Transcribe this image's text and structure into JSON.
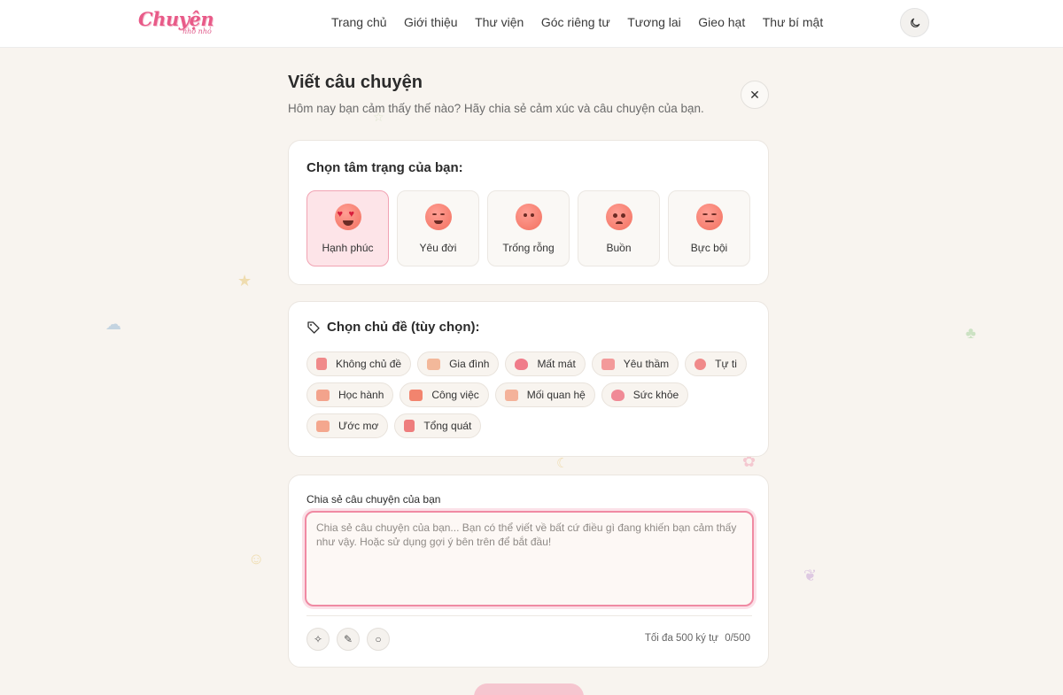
{
  "header": {
    "logo_main": "Chuyện",
    "logo_sub": "nho nhỏ",
    "nav": [
      "Trang chủ",
      "Giới thiệu",
      "Thư viện",
      "Góc riêng tư",
      "Tương lai",
      "Gieo hạt",
      "Thư bí mật"
    ],
    "theme_icon": "moon-icon"
  },
  "page": {
    "title": "Viết câu chuyện",
    "subtitle": "Hôm nay bạn cảm thấy thế nào? Hãy chia sẻ cảm xúc và câu chuyện của bạn.",
    "close_icon": "close-icon"
  },
  "mood": {
    "heading": "Chọn tâm trạng của bạn:",
    "selected": "Hạnh phúc",
    "options": [
      "Hạnh phúc",
      "Yêu đời",
      "Trống rỗng",
      "Buồn",
      "Bực bội"
    ]
  },
  "topic": {
    "heading": "Chọn chủ đề (tùy chọn):",
    "options": [
      "Không chủ đề",
      "Gia đình",
      "Mất mát",
      "Yêu thầm",
      "Tự ti",
      "Học hành",
      "Công việc",
      "Mối quan hệ",
      "Sức khỏe",
      "Ước mơ",
      "Tổng quát"
    ]
  },
  "story": {
    "label": "Chia sẻ câu chuyện của bạn",
    "value": "",
    "placeholder": "Chia sẻ câu chuyện của bạn... Bạn có thể viết về bất cứ điều gì đang khiến bạn cảm thấy như vậy. Hoặc sử dụng gợi ý bên trên để bắt đầu!",
    "limit_text": "Tối đa 500 ký tự",
    "counter": "0/500",
    "tools": [
      "sparkle-icon",
      "pencil-icon",
      "circle-icon"
    ]
  },
  "colors": {
    "accent": "#f08aa3",
    "active_mood_bg": "#fde4e8",
    "background": "#f8f4ef"
  }
}
